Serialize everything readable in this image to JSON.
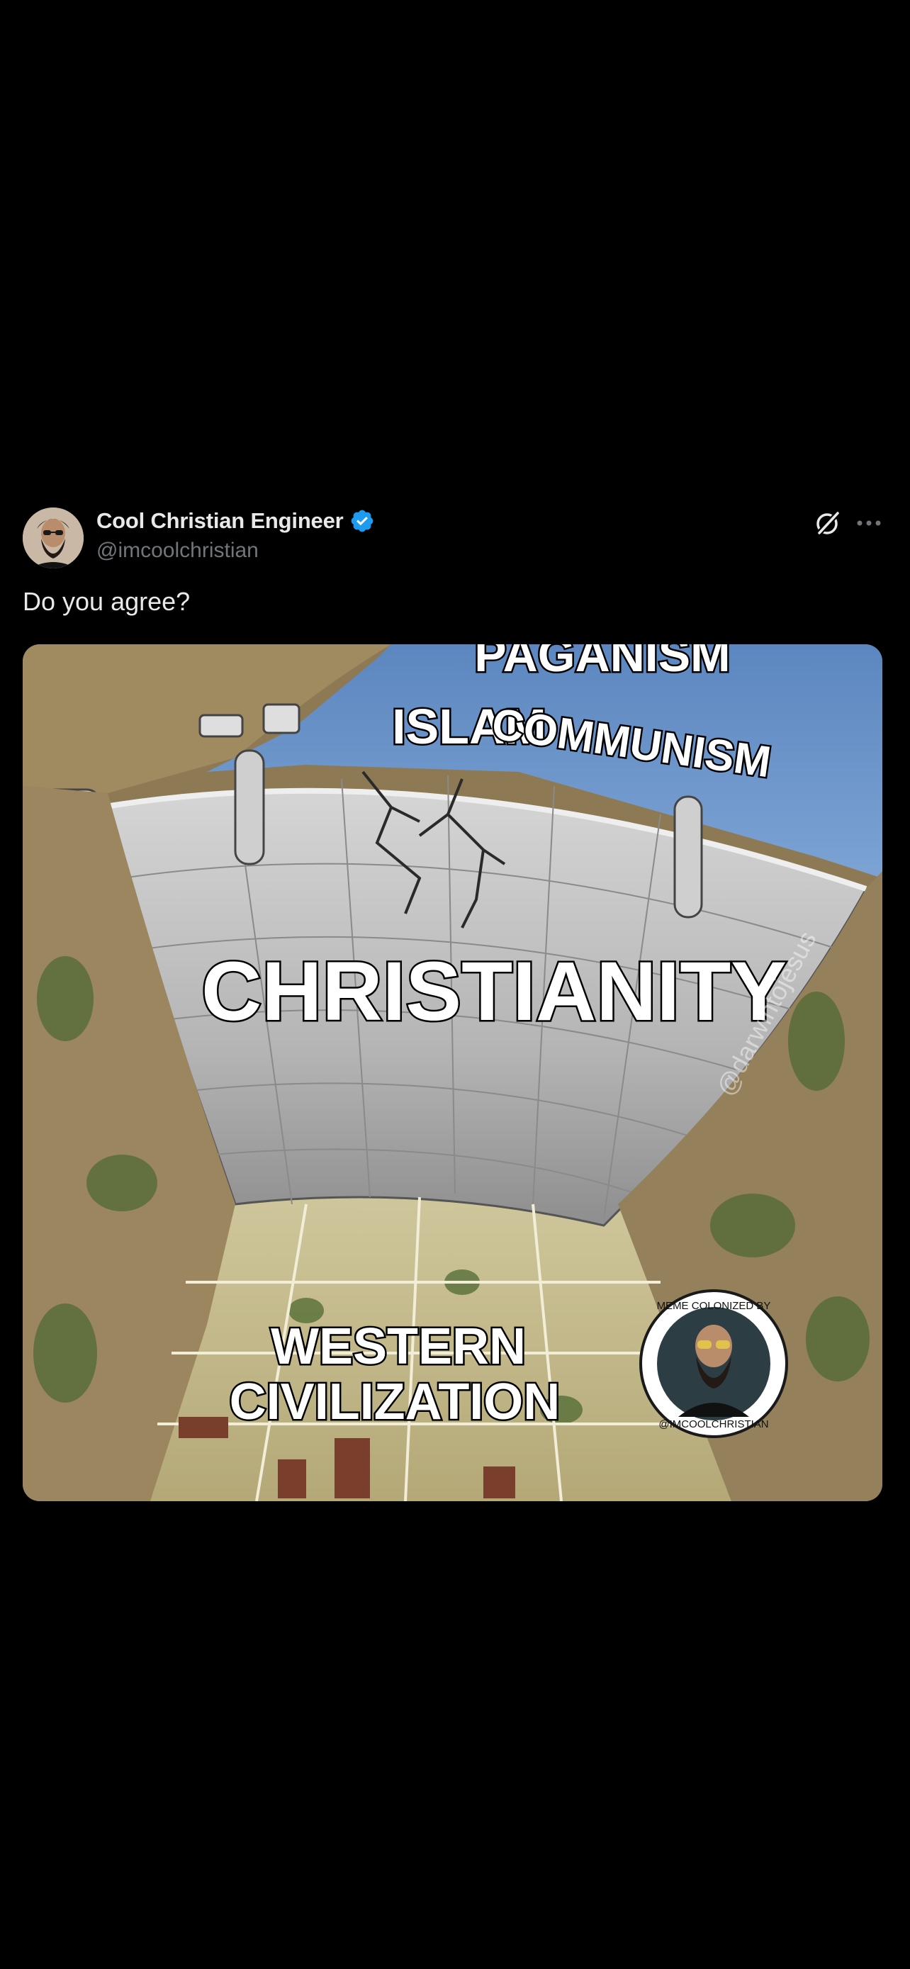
{
  "tweet": {
    "author": {
      "name": "Cool Christian Engineer",
      "handle": "@imcoolchristian",
      "verified": true,
      "avatar_icon": "bearded-man-avatar"
    },
    "text": "Do you agree?",
    "actions": {
      "grok_icon": "grok-icon",
      "more_icon": "more-options-icon"
    },
    "media": {
      "labels": {
        "paganism": "PAGANISM",
        "islam": "ISLAM",
        "communism": "COMMUNISM",
        "christianity": "CHRISTIANITY",
        "western_civilization_line1": "WESTERN",
        "western_civilization_line2": "CIVILIZATION"
      },
      "watermark": "@darwintojesus",
      "stamp_text_top": "MEME COLONIZED BY",
      "stamp_text_bottom": "@IMCOOLCHRISTIAN"
    }
  },
  "colors": {
    "background": "#000000",
    "text_primary": "#e7e9ea",
    "text_secondary": "#71767b",
    "verified_badge": "#1d9bf0",
    "water": "#6b93c8",
    "dam_concrete": "#b9b9b9",
    "cliff": "#9c8660"
  }
}
